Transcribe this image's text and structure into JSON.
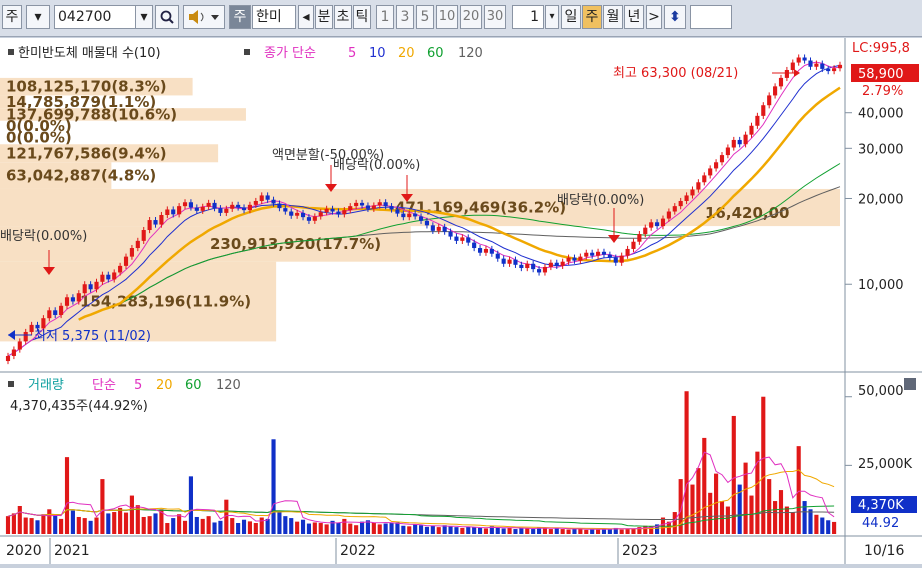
{
  "toolbar": {
    "market_label": "주",
    "code_value": "042700",
    "type_label": "주",
    "stock_name": "한미",
    "tick_buttons": [
      "분",
      "초",
      "틱"
    ],
    "num_buttons": [
      "1",
      "3",
      "5",
      "10",
      "20",
      "30"
    ],
    "count_value": "1",
    "period_buttons": [
      "일",
      "주",
      "월",
      "년"
    ],
    "period_selected": "주"
  },
  "colors": {
    "up": "#e01818",
    "down": "#1030c8",
    "ma5": "#e030c0",
    "ma10": "#2030d0",
    "ma20": "#f0a800",
    "ma60": "#10a030",
    "ma120": "#606060",
    "highlight": "#f8e0c4"
  },
  "chart_data": [
    {
      "type": "candlestick",
      "title": "한미반도체 매물대 수(10)",
      "legend": {
        "price_label": "종가 단순",
        "ma_periods": [
          "5",
          "10",
          "20",
          "60",
          "120"
        ]
      },
      "y_scale": "log",
      "ylim": [
        5000,
        72000
      ],
      "y_ticks": [
        "40,000",
        "30,000",
        "20,000",
        "10,000"
      ],
      "lc_label": "LC:995,8",
      "current_price": "58,900",
      "current_change": "2.79%",
      "x_labels": [
        "2020",
        "2021",
        "2022",
        "2023"
      ],
      "date_label": "10/16",
      "high_annotation": "최고 63,300 (08/21)",
      "low_annotation": "최저 5,375 (11/02)",
      "event_annotations": [
        "배당락(0.00%)",
        "액면분할(-50.00%)",
        "배당락(0.00%)",
        "배당락(0.00%)"
      ],
      "volume_profile": [
        {
          "label": "108,125,170(8.3%)",
          "low": 46000,
          "high": 53000
        },
        {
          "label": "14,785,879(1.1%)",
          "low": 41500,
          "high": 46000
        },
        {
          "label": "137,699,788(10.6%)",
          "low": 37500,
          "high": 41500
        },
        {
          "label": "0(0.0%)",
          "low": 34500,
          "high": 37500
        },
        {
          "label": "0(0.0%)",
          "low": 31000,
          "high": 34500
        },
        {
          "label": "121,767,586(9.4%)",
          "low": 26800,
          "high": 31000
        },
        {
          "label": "63,042,887(4.8%)",
          "low": 21600,
          "high": 26800
        },
        {
          "label": "471,169,469(36.2%)",
          "low": 16000,
          "high": 21600
        },
        {
          "label": "230,913,920(17.7%)",
          "low": 12000,
          "high": 16000
        },
        {
          "label": "154,283,196(11.9%)",
          "low": 6300,
          "high": 12000
        }
      ],
      "bands_partial": [
        {
          "label": "16,420,00",
          "low": 16500,
          "high": 19500
        }
      ],
      "candles_close": [
        5600,
        5900,
        6300,
        6800,
        7200,
        7000,
        7600,
        8100,
        7800,
        8400,
        9000,
        8700,
        9300,
        10000,
        9600,
        10200,
        10800,
        10400,
        11000,
        11600,
        12500,
        13400,
        14200,
        15500,
        16800,
        16200,
        17500,
        18300,
        17600,
        18800,
        19400,
        18600,
        18100,
        18700,
        19300,
        18500,
        17800,
        18400,
        19000,
        18600,
        18200,
        19000,
        19600,
        20500,
        19800,
        19200,
        18500,
        18000,
        17400,
        17800,
        17200,
        16700,
        17300,
        17900,
        18400,
        18000,
        17600,
        18200,
        18800,
        19300,
        18900,
        18400,
        18900,
        19400,
        18800,
        18300,
        17700,
        17200,
        17700,
        17300,
        16700,
        16100,
        15400,
        15900,
        15300,
        14700,
        14200,
        14600,
        14000,
        13400,
        12900,
        13300,
        12800,
        12300,
        11800,
        12200,
        11700,
        11400,
        11800,
        11300,
        11000,
        11500,
        11900,
        11600,
        12000,
        12400,
        12100,
        12500,
        12900,
        12600,
        13000,
        12700,
        12400,
        11900,
        12600,
        13300,
        14100,
        15000,
        15800,
        16500,
        16000,
        17000,
        18000,
        18800,
        19600,
        20500,
        21500,
        22800,
        24100,
        25500,
        26800,
        28400,
        30200,
        32100,
        31000,
        33500,
        36000,
        39000,
        42500,
        46000,
        49500,
        53000,
        56500,
        60000,
        62500,
        61000,
        58000,
        59500,
        57000,
        56000,
        57300,
        58900
      ],
      "volume_values": [
        6.5,
        7.5,
        10.2,
        6.0,
        5.8,
        5.0,
        7.2,
        9.0,
        6.8,
        5.5,
        28.0,
        8.5,
        6.2,
        5.8,
        4.8,
        6.0,
        20.0,
        7.5,
        8.0,
        9.5,
        7.8,
        14.0,
        10.5,
        6.2,
        6.5,
        7.5,
        9.0,
        4.0,
        5.8,
        7.2,
        4.8,
        21.0,
        6.2,
        5.5,
        6.5,
        4.2,
        4.8,
        12.5,
        5.8,
        4.0,
        5.2,
        4.6,
        4.0,
        6.0,
        5.5,
        34.5,
        8.0,
        6.5,
        5.8,
        4.5,
        5.2,
        3.8,
        4.2,
        4.0,
        3.5,
        4.8,
        4.0,
        5.5,
        3.8,
        3.2,
        4.5,
        5.0,
        4.2,
        3.5,
        3.8,
        4.0,
        4.2,
        3.0,
        2.8,
        3.5,
        3.2,
        2.6,
        3.0,
        2.5,
        3.2,
        2.8,
        2.5,
        2.2,
        2.6,
        2.4,
        2.2,
        2.0,
        2.8,
        2.4,
        2.0,
        2.3,
        1.8,
        2.2,
        2.0,
        1.8,
        2.5,
        2.2,
        1.8,
        2.0,
        1.8,
        1.6,
        2.0,
        1.8,
        1.5,
        1.8,
        1.6,
        2.0,
        1.8,
        2.2,
        1.6,
        1.8,
        2.0,
        2.5,
        3.0,
        2.8,
        3.5,
        6.0,
        4.5,
        8.0,
        20.0,
        52.0,
        18.0,
        24.0,
        35.0,
        15.0,
        22.0,
        12.0,
        10.0,
        43.0,
        18.0,
        26.0,
        14.0,
        30.0,
        50.0,
        20.0,
        12.0,
        16.0,
        10.0,
        8.0,
        32.0,
        12.0,
        9.0,
        7.0,
        6.0,
        5.0,
        4.4
      ],
      "volume_ticks": [
        "50,000",
        "25,000K"
      ],
      "volume_legend": {
        "label": "거래량",
        "ma_label": "단순",
        "ma_periods": [
          "5",
          "20",
          "60",
          "120"
        ]
      },
      "volume_current": "4,370,435주(44.92%)",
      "volume_current_tag": "4,370K",
      "volume_ratio_tag": "44.92"
    }
  ]
}
